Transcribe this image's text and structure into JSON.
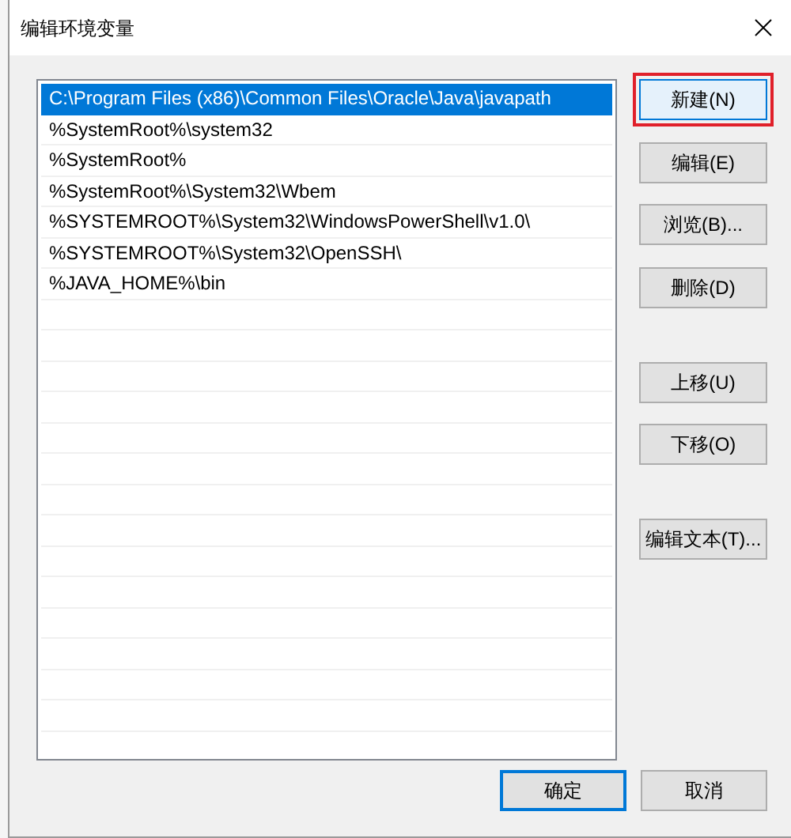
{
  "window": {
    "title": "编辑环境变量"
  },
  "entries": [
    {
      "text": "C:\\Program Files (x86)\\Common Files\\Oracle\\Java\\javapath",
      "selected": true
    },
    {
      "text": "%SystemRoot%\\system32",
      "selected": false
    },
    {
      "text": "%SystemRoot%",
      "selected": false
    },
    {
      "text": "%SystemRoot%\\System32\\Wbem",
      "selected": false
    },
    {
      "text": "%SYSTEMROOT%\\System32\\WindowsPowerShell\\v1.0\\",
      "selected": false
    },
    {
      "text": "%SYSTEMROOT%\\System32\\OpenSSH\\",
      "selected": false
    },
    {
      "text": "%JAVA_HOME%\\bin",
      "selected": false
    }
  ],
  "button_groups": [
    [
      {
        "label": "新建(N)",
        "highlighted": true
      },
      {
        "label": "编辑(E)",
        "highlighted": false
      },
      {
        "label": "浏览(B)...",
        "highlighted": false
      },
      {
        "label": "删除(D)",
        "highlighted": false
      }
    ],
    [
      {
        "label": "上移(U)",
        "highlighted": false
      },
      {
        "label": "下移(O)",
        "highlighted": false
      }
    ],
    [
      {
        "label": "编辑文本(T)...",
        "highlighted": false
      }
    ]
  ],
  "footer_buttons": [
    {
      "label": "确定",
      "default": true
    },
    {
      "label": "取消",
      "default": false
    }
  ]
}
